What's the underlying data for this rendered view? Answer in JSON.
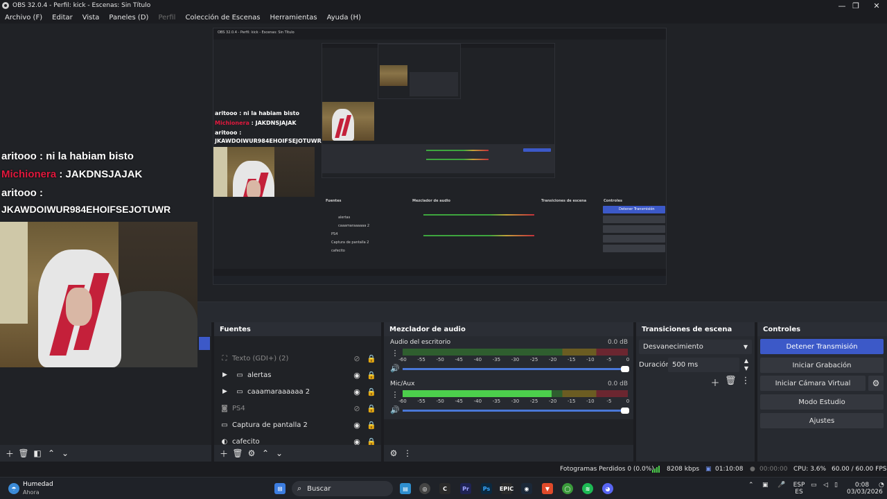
{
  "window": {
    "title": "OBS 32.0.4 - Perfil: kick - Escenas: Sin Título",
    "minimize": "—",
    "maximize": "❐",
    "close": "✕"
  },
  "menu": {
    "archivo": "Archivo (F)",
    "editar": "Editar",
    "vista": "Vista",
    "paneles": "Paneles (D)",
    "perfil": "Perfil",
    "coleccion": "Colección de Escenas",
    "herramientas": "Herramientas",
    "ayuda": "Ayuda (H)"
  },
  "preview": {
    "chat": [
      {
        "user": "aritooo",
        "sep": " : ",
        "message": "ni la habiam bisto"
      },
      {
        "user": "Michionera",
        "sep": " : ",
        "message": "JAKDNSJAJAK"
      },
      {
        "user": "aritooo",
        "sep": " :",
        "message": ""
      },
      {
        "user": "",
        "sep": "",
        "message": "JKAWDOIWUR984EHOIFSEJOTUWR"
      }
    ]
  },
  "sources": {
    "header": "Fuentes",
    "items": [
      {
        "label": "Texto (GDI+) (2)"
      },
      {
        "label": "alertas"
      },
      {
        "label": "caaamaraaaaaa 2"
      },
      {
        "label": "PS4"
      },
      {
        "label": "Captura de pantalla 2"
      },
      {
        "label": "cafecito"
      }
    ]
  },
  "mixer": {
    "header": "Mezclador de audio",
    "channels": [
      {
        "name": "Audio del escritorio",
        "db": "0.0 dB",
        "level": 0.0
      },
      {
        "name": "Mic/Aux",
        "db": "0.0 dB",
        "level": 0.66
      }
    ],
    "ticks": [
      "-60",
      "-55",
      "-50",
      "-45",
      "-40",
      "-35",
      "-30",
      "-25",
      "-20",
      "-15",
      "-10",
      "-5",
      "0"
    ]
  },
  "transitions": {
    "header": "Transiciones de escena",
    "selected": "Desvanecimiento",
    "duration_label": "Duración",
    "duration_value": "500 ms"
  },
  "controls": {
    "header": "Controles",
    "stop_stream": "Detener Transmisión",
    "start_record": "Iniciar Grabación",
    "virtual_cam": "Iniciar Cámara Virtual",
    "studio_mode": "Modo Estudio",
    "settings": "Ajustes"
  },
  "status": {
    "dropped": "Fotogramas Perdidos 0 (0.0%)",
    "bitrate": "8208 kbps",
    "stream_time": "01:10:08",
    "rec_time": "00:00:00",
    "cpu": "CPU: 3.6%",
    "fps": "60.00 / 60.00 FPS"
  },
  "taskbar": {
    "weather_title": "Humedad",
    "weather_sub": "Ahora",
    "search": "Buscar",
    "lang_top": "ESP",
    "lang_bottom": "ES",
    "time": "0:08",
    "date": "03/03/2026"
  },
  "colors": {
    "accent": "#3c59c8",
    "chat_red": "#e0183d",
    "meter_green": "#4ccf4c",
    "panel_bg": "#272a30"
  }
}
